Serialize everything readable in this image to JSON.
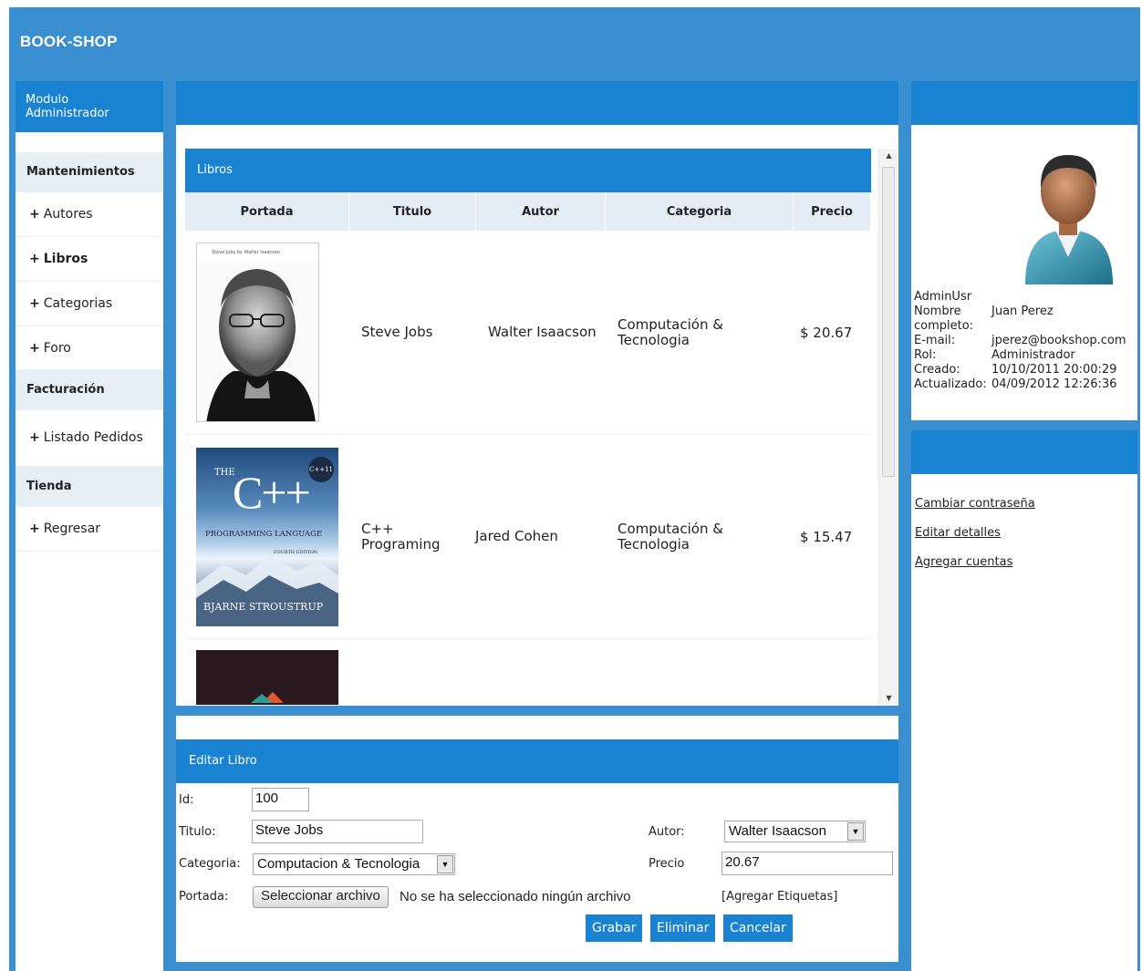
{
  "app": {
    "brand": "BOOK-SHOP"
  },
  "sidebar": {
    "title": "Modulo Administrador",
    "sections": [
      {
        "label": "Mantenimientos",
        "items": [
          "Autores",
          "Libros",
          "Categorias",
          "Foro"
        ]
      },
      {
        "label": "Facturación",
        "items": [
          "Listado Pedidos"
        ]
      },
      {
        "label": "Tienda",
        "items": [
          "Regresar"
        ]
      }
    ],
    "active_item": "Libros"
  },
  "books": {
    "title": "Libros",
    "columns": [
      "Portada",
      "Titulo",
      "Autor",
      "Categoria",
      "Precio"
    ],
    "rows": [
      {
        "titulo": "Steve Jobs",
        "autor": "Walter Isaacson",
        "categoria": "Computación & Tecnologia",
        "precio": "$ 20.67"
      },
      {
        "titulo": "C++ Programing",
        "autor": "Jared Cohen",
        "categoria": "Computación & Tecnologia",
        "precio": "$ 15.47"
      }
    ]
  },
  "covers": {
    "jobs_top": "Steve Jobs by Walter Isaacson",
    "cpp_the": "THE",
    "cpp_big": "C++",
    "cpp_sub": "PROGRAMMING LANGUAGE",
    "cpp_edition": "FOURTH EDITION",
    "cpp_badge": "C++11",
    "cpp_author": "BJARNE STROUSTRUP"
  },
  "edit": {
    "title": "Editar Libro",
    "id_label": "Id:",
    "id_value": "100",
    "titulo_label": "Titulo:",
    "titulo_value": "Steve Jobs",
    "categoria_label": "Categoria:",
    "categoria_value": "Computacion & Tecnologia",
    "portada_label": "Portada:",
    "file_button": "Seleccionar archivo",
    "file_status": "No se ha seleccionado ningún archivo",
    "autor_label": "Autor:",
    "autor_value": "Walter Isaacson",
    "precio_label": "Precio",
    "precio_value": "20.67",
    "tags_link": "[Agregar Etiquetas]",
    "buttons": {
      "save": "Grabar",
      "delete": "Eliminar",
      "cancel": "Cancelar"
    }
  },
  "user": {
    "username": "AdminUsr",
    "fields": [
      {
        "key": "Nombre completo:",
        "value": "Juan Perez"
      },
      {
        "key": "E-mail:",
        "value": "jperez@bookshop.com"
      },
      {
        "key": "Rol:",
        "value": "Administrador"
      },
      {
        "key": "Creado:",
        "value": "10/10/2011 20:00:29"
      },
      {
        "key": "Actualizado:",
        "value": "04/09/2012 12:26:36"
      }
    ]
  },
  "account_links": [
    "Cambiar contraseña",
    "Editar detalles",
    "Agregar cuentas"
  ],
  "colors": {
    "header": "#3a8fd1",
    "panel_head": "#1a83d1",
    "section_bg": "#e6eef6"
  }
}
